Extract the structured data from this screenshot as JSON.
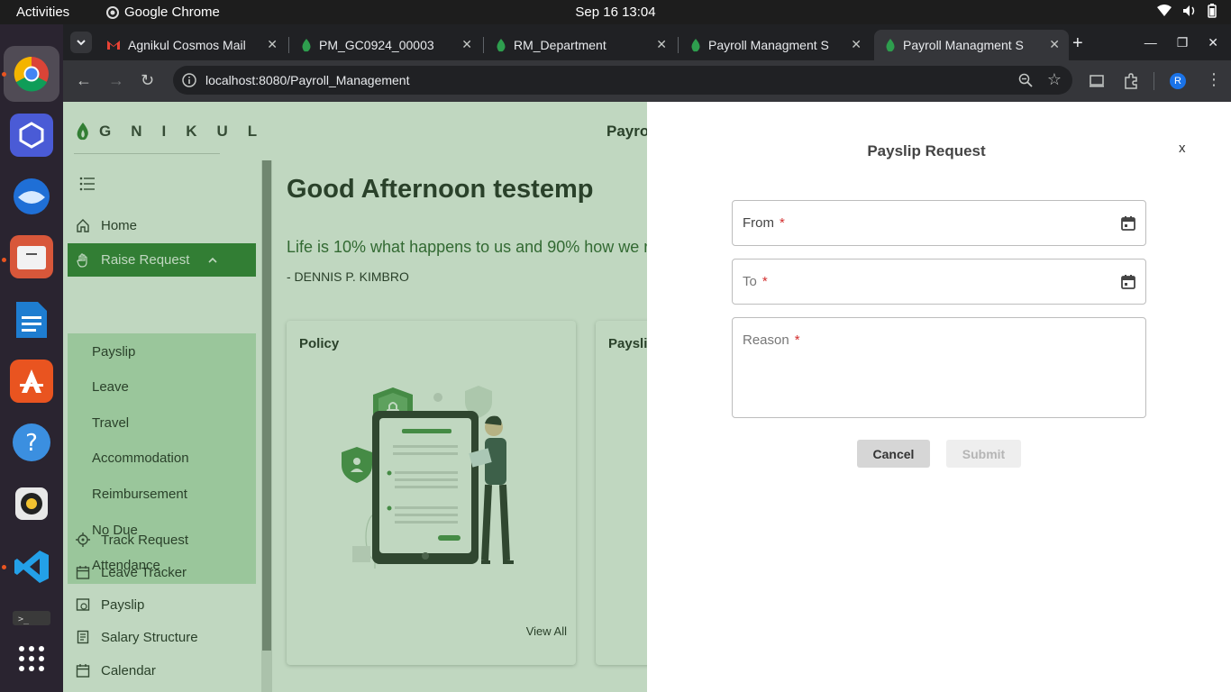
{
  "system": {
    "activities": "Activities",
    "app_name": "Google Chrome",
    "datetime": "Sep 16  13:04"
  },
  "browser": {
    "tabs": [
      {
        "title": "Agnikul Cosmos Mail"
      },
      {
        "title": "PM_GC0924_00003"
      },
      {
        "title": "RM_Department"
      },
      {
        "title": "Payroll Managment S"
      },
      {
        "title": "Payroll Managment S"
      }
    ],
    "url": "localhost:8080/Payroll_Management",
    "profile_initial": "R"
  },
  "app": {
    "logo_text": "GNIKUL",
    "header_title": "Payro",
    "sidebar": {
      "home": "Home",
      "raise_request": "Raise Request",
      "sub_items": [
        "Payslip",
        "Leave",
        "Travel",
        "Accommodation",
        "Reimbursement",
        "No Due",
        "Attendance"
      ],
      "track_request": "Track Request",
      "leave_tracker": "Leave Tracker",
      "payslip": "Payslip",
      "salary_structure": "Salary Structure",
      "calendar": "Calendar"
    },
    "greeting": "Good Afternoon  testemp",
    "quote": "Life is 10% what happens to us and 90% how we r",
    "quote_author": "- DENNIS P. KIMBRO",
    "cards": {
      "policy_title": "Policy",
      "policy_link": "View All",
      "payslip_title": "Paysli"
    }
  },
  "drawer": {
    "title": "Payslip Request",
    "close": "x",
    "from_label": "From",
    "to_label": "To",
    "reason_label": "Reason",
    "required_mark": "*",
    "cancel": "Cancel",
    "submit": "Submit"
  },
  "colors": {
    "brand_green": "#2e7d32",
    "submenu_bg": "#c8e6c9",
    "required": "#d32f2f"
  }
}
